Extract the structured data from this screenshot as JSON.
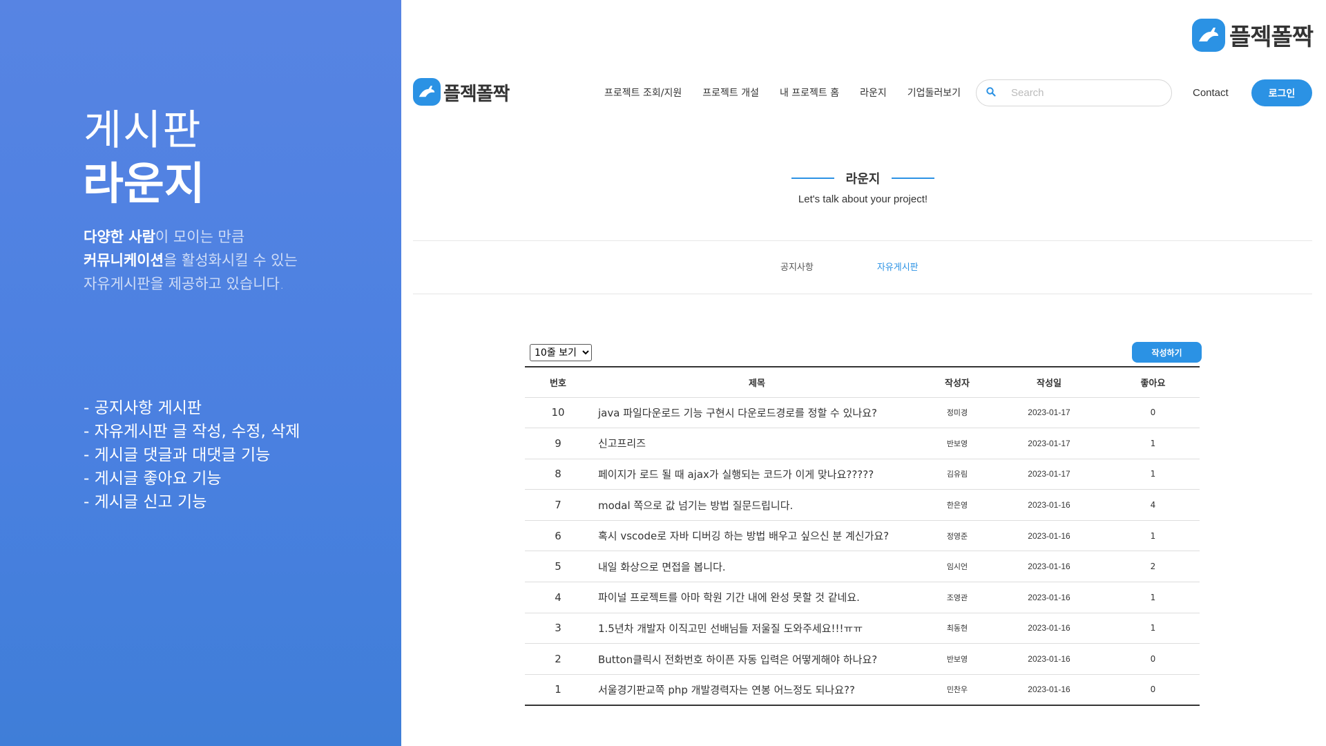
{
  "left_panel": {
    "title_light": "게시판",
    "title_bold": "라운지",
    "desc": [
      {
        "bold": "다양한 사람",
        "rest": "이 모이는 만큼"
      },
      {
        "bold": "커뮤니케이션",
        "rest": "을 활성화시킬 수 있는"
      },
      {
        "bold": "",
        "rest": "자유게시판을 제공하고 있습니다."
      }
    ],
    "features": [
      "- 공지사항 게시판",
      "- 자유게시판 글 작성, 수정, 삭제",
      "- 게시글 댓글과 대댓글 기능",
      "- 게시글 좋아요 기능",
      "- 게시글 신고 기능"
    ]
  },
  "brand": {
    "name": "플젝폴짝",
    "color": "#2b92e4",
    "icon": "rabbit-logo-icon"
  },
  "nav": {
    "items": [
      "프로젝트 조회/지원",
      "프로젝트 개설",
      "내 프로젝트 홈",
      "라운지",
      "기업둘러보기"
    ],
    "search_placeholder": "Search",
    "contact": "Contact",
    "login": "로그인"
  },
  "page": {
    "title": "라운지",
    "subtitle": "Let's talk about your project!",
    "tabs": [
      "공지사항",
      "자유게시판"
    ],
    "active_tab": "자유게시판"
  },
  "board": {
    "page_size_option": "10줄 보기",
    "write_button": "작성하기",
    "columns": [
      "번호",
      "제목",
      "작성자",
      "작성일",
      "좋아요"
    ],
    "rows": [
      {
        "no": "10",
        "title": "java 파일다운로드 기능 구현시 다운로드경로를 정할 수 있나요?",
        "author": "정미경",
        "date": "2023-01-17",
        "likes": "0"
      },
      {
        "no": "9",
        "title": "신고프리즈",
        "author": "반보영",
        "date": "2023-01-17",
        "likes": "1"
      },
      {
        "no": "8",
        "title": "페이지가 로드 될 때 ajax가 실행되는 코드가 이게 맞나요?????",
        "author": "김유림",
        "date": "2023-01-17",
        "likes": "1"
      },
      {
        "no": "7",
        "title": "modal 쪽으로 값 넘기는 방법 질문드립니다.",
        "author": "한은영",
        "date": "2023-01-16",
        "likes": "4"
      },
      {
        "no": "6",
        "title": "혹시 vscode로 자바 디버깅 하는 방법 배우고 싶으신 분 계신가요?",
        "author": "정영준",
        "date": "2023-01-16",
        "likes": "1"
      },
      {
        "no": "5",
        "title": "내일 화상으로 면접을 봅니다.",
        "author": "임시언",
        "date": "2023-01-16",
        "likes": "2"
      },
      {
        "no": "4",
        "title": "파이널 프로젝트를 아마 학원 기간 내에 완성 못할 것 같네요.",
        "author": "조영관",
        "date": "2023-01-16",
        "likes": "1"
      },
      {
        "no": "3",
        "title": "1.5년차 개발자 이직고민 선배님들 저울질 도와주세요!!!ㅠㅠ",
        "author": "최동현",
        "date": "2023-01-16",
        "likes": "1"
      },
      {
        "no": "2",
        "title": "Button클릭시 전화번호 하이픈 자동 입력은 어떻게해야 하나요?",
        "author": "반보영",
        "date": "2023-01-16",
        "likes": "0"
      },
      {
        "no": "1",
        "title": "서울경기판교쪽 php 개발경력자는 연봉 어느정도 되나요??",
        "author": "민찬우",
        "date": "2023-01-16",
        "likes": "0"
      }
    ]
  }
}
